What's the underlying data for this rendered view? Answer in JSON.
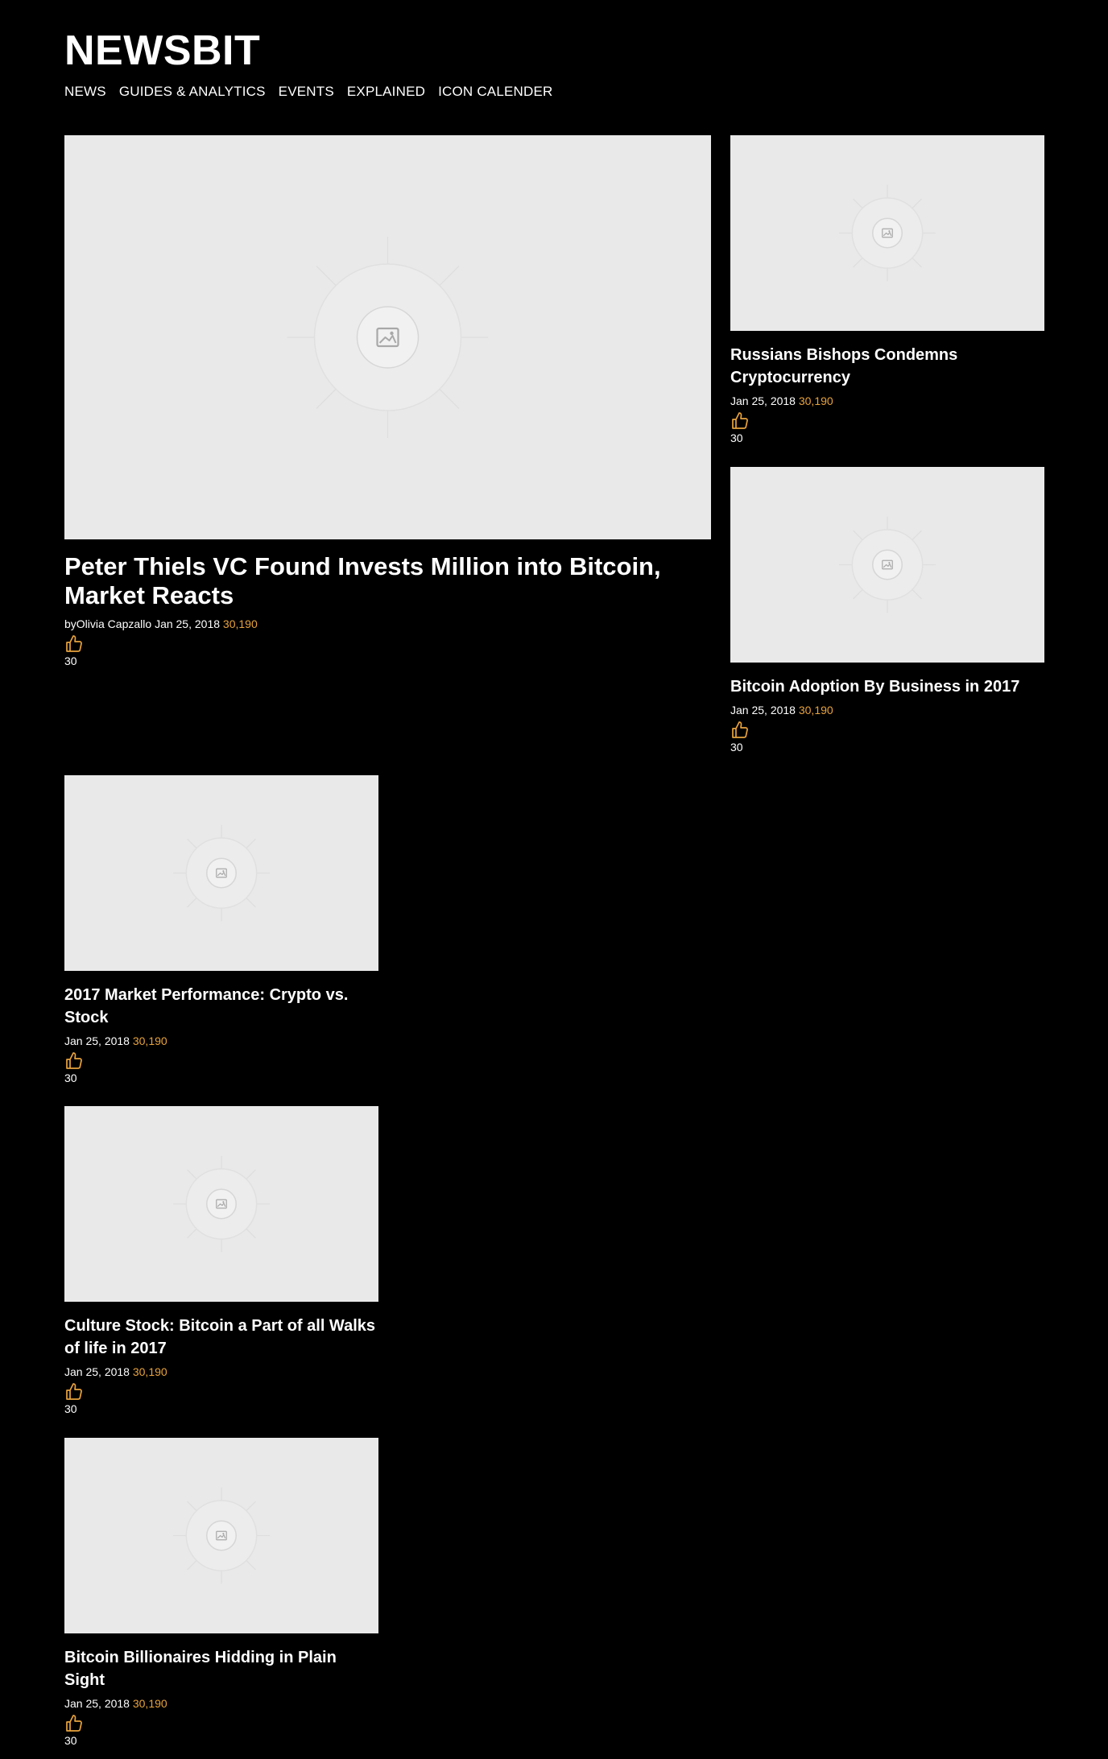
{
  "site": {
    "logo": "NEWSBIT"
  },
  "nav": [
    "NEWS",
    "GUIDES & ANALYTICS",
    "EVENTS",
    "EXPLAINED",
    "ICON CALENDER"
  ],
  "colors": {
    "background": "#000000",
    "accent": "#e8a33d",
    "placeholder": "#e9e9e9"
  },
  "icons": {
    "image_placeholder": "image-icon",
    "like": "thumbs-up-icon"
  },
  "featured": {
    "title": "Peter Thiels VC Found Invests Million into Bitcoin, Market Reacts",
    "byline": "byOlivia Capzallo",
    "date": "Jan 25, 2018",
    "views": "30,190",
    "likes": "30"
  },
  "side_articles": [
    {
      "title": "Russians Bishops Condemns Cryptocurrency",
      "date": "Jan 25, 2018",
      "views": "30,190",
      "likes": "30"
    },
    {
      "title": "Bitcoin Adoption By Business in 2017",
      "date": "Jan 25, 2018",
      "views": "30,190",
      "likes": "30"
    }
  ],
  "list_articles": [
    {
      "title": "2017 Market Performance: Crypto vs. Stock",
      "date": "Jan 25, 2018",
      "views": "30,190",
      "likes": "30"
    },
    {
      "title": "Culture Stock: Bitcoin a Part of all Walks of life in 2017",
      "date": "Jan 25, 2018",
      "views": "30,190",
      "likes": "30"
    },
    {
      "title": "Bitcoin Billionaires Hidding in Plain Sight",
      "date": "Jan 25, 2018",
      "views": "30,190",
      "likes": "30"
    }
  ]
}
